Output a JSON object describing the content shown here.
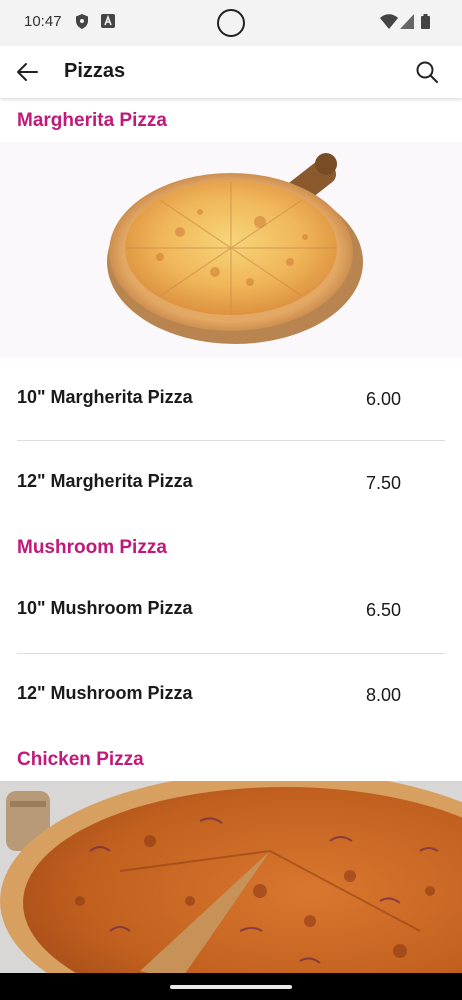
{
  "status_bar": {
    "time": "10:47",
    "icons": [
      "shield-icon",
      "a-box-icon",
      "wifi-icon",
      "signal-icon",
      "battery-icon"
    ]
  },
  "app_bar": {
    "title": "Pizzas",
    "back_icon": "arrow-left-icon",
    "search_icon": "search-icon"
  },
  "colors": {
    "accent": "#c2187a",
    "text": "#1a1a1a",
    "divider": "#dddddd"
  },
  "sections": [
    {
      "title": "Margherita Pizza",
      "image": "margherita-pizza-photo",
      "items": [
        {
          "name": "10\" Margherita Pizza",
          "price": "6.00"
        },
        {
          "name": "12\" Margherita Pizza",
          "price": "7.50"
        }
      ]
    },
    {
      "title": "Mushroom Pizza",
      "items": [
        {
          "name": "10\" Mushroom Pizza",
          "price": "6.50"
        },
        {
          "name": "12\" Mushroom Pizza",
          "price": "8.00"
        }
      ]
    },
    {
      "title": "Chicken Pizza",
      "image": "chicken-pizza-photo",
      "items": []
    }
  ]
}
